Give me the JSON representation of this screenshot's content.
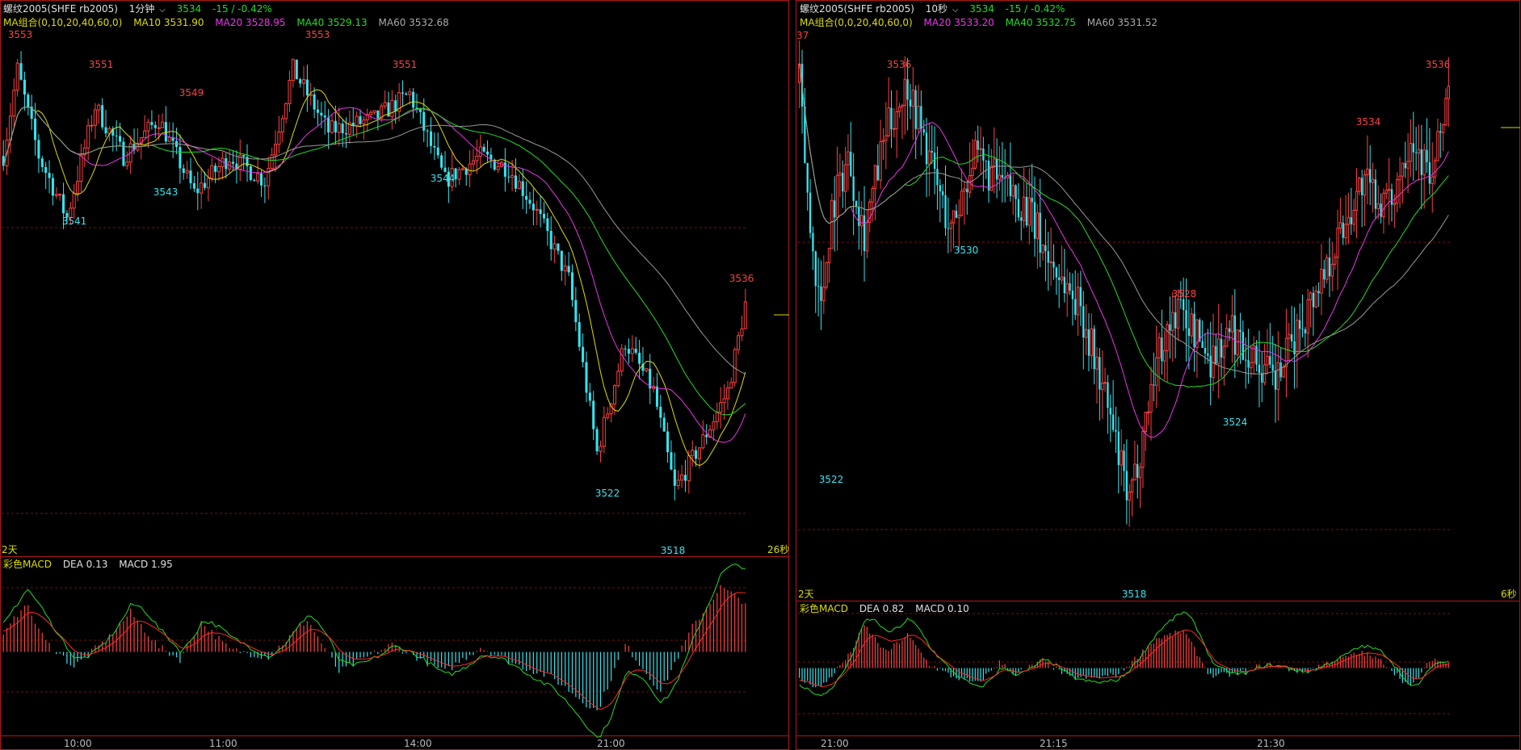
{
  "colors": {
    "up": "#ff4040",
    "down": "#33e5f0",
    "grid": "#7a1010",
    "frame": "#b01818",
    "ma10": "#dddd00",
    "ma20": "#ee33ee",
    "ma40": "#22dd22",
    "ma60": "#999999",
    "dif": "#22dd22",
    "dea": "#ff2a2a"
  },
  "left": {
    "header": {
      "symbol": "螺纹2005(SHFE rb2005)",
      "period": "1分钟",
      "price": "3534",
      "change": "-15 / -0.42%"
    },
    "ma_bar": {
      "name": "MA组合(0,10,20,40,60,0)",
      "ma10": "MA10 3531.90",
      "ma20": "MA20 3528.95",
      "ma40": "MA40 3529.13",
      "ma60": "MA60 3532.68"
    },
    "macd_bar": {
      "name": "彩色MACD",
      "dea": "DEA 0.13",
      "macd": "MACD 1.95"
    },
    "corner_left": "2天",
    "corner_right": "26秒",
    "time_labels": [
      "10:00",
      "11:00",
      "14:00",
      "21:00"
    ],
    "annotations": [
      {
        "text": "3553",
        "kind": "high"
      },
      {
        "text": "3551",
        "kind": "high"
      },
      {
        "text": "3549",
        "kind": "high"
      },
      {
        "text": "3553",
        "kind": "high"
      },
      {
        "text": "3551",
        "kind": "high"
      },
      {
        "text": "3541",
        "kind": "low"
      },
      {
        "text": "3543",
        "kind": "low"
      },
      {
        "text": "3544",
        "kind": "low"
      },
      {
        "text": "3522",
        "kind": "low"
      },
      {
        "text": "3518",
        "kind": "low"
      },
      {
        "text": "3536",
        "kind": "high"
      }
    ]
  },
  "right": {
    "header": {
      "symbol": "螺纹2005(SHFE rb2005)",
      "period": "10秒",
      "price": "3534",
      "change": "-15 / -0.42%"
    },
    "ma_bar": {
      "name": "MA组合(0,0,20,40,60,0)",
      "ma20": "MA20 3533.20",
      "ma40": "MA40 3532.75",
      "ma60": "MA60 3531.52"
    },
    "macd_bar": {
      "name": "彩色MACD",
      "dea": "DEA 0.82",
      "macd": "MACD 0.10"
    },
    "corner_top": "37",
    "corner_left": "2天",
    "corner_right": "6秒",
    "time_labels": [
      "21:00",
      "21:15",
      "21:30"
    ],
    "annotations": [
      {
        "text": "3536",
        "kind": "high"
      },
      {
        "text": "3530",
        "kind": "low"
      },
      {
        "text": "3522",
        "kind": "low"
      },
      {
        "text": "3528",
        "kind": "high"
      },
      {
        "text": "3518",
        "kind": "low"
      },
      {
        "text": "3524",
        "kind": "low"
      },
      {
        "text": "3534",
        "kind": "high"
      },
      {
        "text": "3536",
        "kind": "high"
      }
    ]
  },
  "chart_data": [
    {
      "type": "candlestick",
      "interval": "1分钟",
      "x_tick_labels": [
        "10:00",
        "11:00",
        "14:00",
        "21:00"
      ],
      "ylim": [
        3515,
        3556
      ],
      "anchors": [
        {
          "t": 0,
          "v": 3546
        },
        {
          "t": 4,
          "v": 3553
        },
        {
          "t": 10,
          "v": 3546
        },
        {
          "t": 18,
          "v": 3541
        },
        {
          "t": 26,
          "v": 3550
        },
        {
          "t": 34,
          "v": 3546
        },
        {
          "t": 44,
          "v": 3549
        },
        {
          "t": 54,
          "v": 3543
        },
        {
          "t": 64,
          "v": 3546
        },
        {
          "t": 74,
          "v": 3544
        },
        {
          "t": 82,
          "v": 3553
        },
        {
          "t": 92,
          "v": 3548
        },
        {
          "t": 105,
          "v": 3549
        },
        {
          "t": 115,
          "v": 3551
        },
        {
          "t": 125,
          "v": 3544
        },
        {
          "t": 135,
          "v": 3546
        },
        {
          "t": 143,
          "v": 3545
        },
        {
          "t": 150,
          "v": 3542
        },
        {
          "t": 160,
          "v": 3536
        },
        {
          "t": 168,
          "v": 3522
        },
        {
          "t": 176,
          "v": 3531
        },
        {
          "t": 184,
          "v": 3527
        },
        {
          "t": 190,
          "v": 3519
        },
        {
          "t": 198,
          "v": 3523
        },
        {
          "t": 205,
          "v": 3527
        },
        {
          "t": 210,
          "v": 3534
        }
      ],
      "macd_anchors": [
        {
          "t": 0,
          "h": 0.6
        },
        {
          "t": 6,
          "h": 2.0
        },
        {
          "t": 12,
          "h": 0.4
        },
        {
          "t": 20,
          "h": -0.6
        },
        {
          "t": 30,
          "h": 0.6
        },
        {
          "t": 36,
          "h": 1.6
        },
        {
          "t": 44,
          "h": 0.2
        },
        {
          "t": 50,
          "h": -0.3
        },
        {
          "t": 56,
          "h": 1.2
        },
        {
          "t": 64,
          "h": 0.1
        },
        {
          "t": 75,
          "h": -0.2
        },
        {
          "t": 86,
          "h": 1.3
        },
        {
          "t": 95,
          "h": -0.8
        },
        {
          "t": 110,
          "h": 0.3
        },
        {
          "t": 125,
          "h": -0.8
        },
        {
          "t": 135,
          "h": 0.2
        },
        {
          "t": 145,
          "h": -0.5
        },
        {
          "t": 155,
          "h": -1.0
        },
        {
          "t": 168,
          "h": -2.4
        },
        {
          "t": 176,
          "h": 0.3
        },
        {
          "t": 186,
          "h": -1.6
        },
        {
          "t": 195,
          "h": 1.0
        },
        {
          "t": 203,
          "h": 2.6
        },
        {
          "t": 210,
          "h": 2.0
        }
      ]
    },
    {
      "type": "candlestick",
      "interval": "10秒",
      "x_tick_labels": [
        "21:00",
        "21:15",
        "21:30"
      ],
      "ylim": [
        3516,
        3538
      ],
      "anchors": [
        {
          "t": 0,
          "v": 3536
        },
        {
          "t": 4,
          "v": 3530
        },
        {
          "t": 8,
          "v": 3527
        },
        {
          "t": 12,
          "v": 3531
        },
        {
          "t": 18,
          "v": 3533
        },
        {
          "t": 24,
          "v": 3530
        },
        {
          "t": 32,
          "v": 3534
        },
        {
          "t": 40,
          "v": 3536
        },
        {
          "t": 48,
          "v": 3533
        },
        {
          "t": 56,
          "v": 3530
        },
        {
          "t": 64,
          "v": 3533
        },
        {
          "t": 74,
          "v": 3532
        },
        {
          "t": 84,
          "v": 3531
        },
        {
          "t": 92,
          "v": 3529
        },
        {
          "t": 104,
          "v": 3527
        },
        {
          "t": 114,
          "v": 3523
        },
        {
          "t": 122,
          "v": 3519
        },
        {
          "t": 132,
          "v": 3525
        },
        {
          "t": 140,
          "v": 3527
        },
        {
          "t": 152,
          "v": 3525
        },
        {
          "t": 160,
          "v": 3526
        },
        {
          "t": 168,
          "v": 3525
        },
        {
          "t": 176,
          "v": 3524
        },
        {
          "t": 184,
          "v": 3526
        },
        {
          "t": 196,
          "v": 3529
        },
        {
          "t": 208,
          "v": 3532
        },
        {
          "t": 218,
          "v": 3531
        },
        {
          "t": 226,
          "v": 3534
        },
        {
          "t": 234,
          "v": 3532
        },
        {
          "t": 240,
          "v": 3536
        }
      ],
      "macd_anchors": [
        {
          "t": 0,
          "h": -0.6
        },
        {
          "t": 8,
          "h": -1.0
        },
        {
          "t": 18,
          "h": 0.6
        },
        {
          "t": 24,
          "h": 2.2
        },
        {
          "t": 32,
          "h": 0.8
        },
        {
          "t": 40,
          "h": 1.7
        },
        {
          "t": 48,
          "h": 0.2
        },
        {
          "t": 56,
          "h": -0.4
        },
        {
          "t": 66,
          "h": -0.8
        },
        {
          "t": 74,
          "h": 0.3
        },
        {
          "t": 80,
          "h": -0.3
        },
        {
          "t": 90,
          "h": 0.4
        },
        {
          "t": 100,
          "h": -0.5
        },
        {
          "t": 110,
          "h": -0.5
        },
        {
          "t": 118,
          "h": -0.3
        },
        {
          "t": 132,
          "h": 1.5
        },
        {
          "t": 142,
          "h": 1.9
        },
        {
          "t": 152,
          "h": -0.4
        },
        {
          "t": 162,
          "h": -0.3
        },
        {
          "t": 172,
          "h": 0.2
        },
        {
          "t": 186,
          "h": -0.2
        },
        {
          "t": 198,
          "h": 0.4
        },
        {
          "t": 208,
          "h": 0.8
        },
        {
          "t": 216,
          "h": 0.3
        },
        {
          "t": 226,
          "h": -1.0
        },
        {
          "t": 234,
          "h": 0.5
        },
        {
          "t": 240,
          "h": 0.2
        }
      ]
    }
  ]
}
